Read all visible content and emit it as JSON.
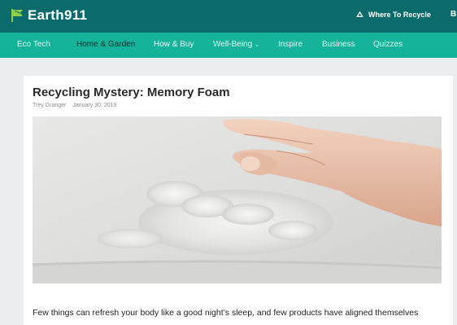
{
  "header": {
    "logo_text": "Earth911",
    "logo_tm": "",
    "where_to_recycle": "Where To Recycle",
    "clipped_text": "B"
  },
  "nav": {
    "items": [
      {
        "label": "Eco Tech"
      },
      {
        "label": "Home & Garden",
        "active": true
      },
      {
        "label": "How & Buy"
      },
      {
        "label": "Well-Being",
        "has_dropdown": true
      },
      {
        "label": "Inspire"
      },
      {
        "label": "Business"
      },
      {
        "label": "Quizzes"
      }
    ],
    "dropdown_caret": "⌄"
  },
  "article": {
    "title": "Recycling Mystery: Memory Foam",
    "author": "Trey Granger",
    "date": "January 30, 2019",
    "hero_image_alt": "",
    "body_first_line": "Few things can refresh your body like a good night’s sleep, and few products have aligned themselves"
  },
  "colors": {
    "topbar": "#0b6b6b",
    "navbar": "#14b39a",
    "page_bg": "#ecedee",
    "card_bg": "#ffffff"
  },
  "icons": {
    "logo": "green-flag-icon",
    "recycle": "recycle-icon",
    "nav_caret": "chevron-down-icon"
  }
}
